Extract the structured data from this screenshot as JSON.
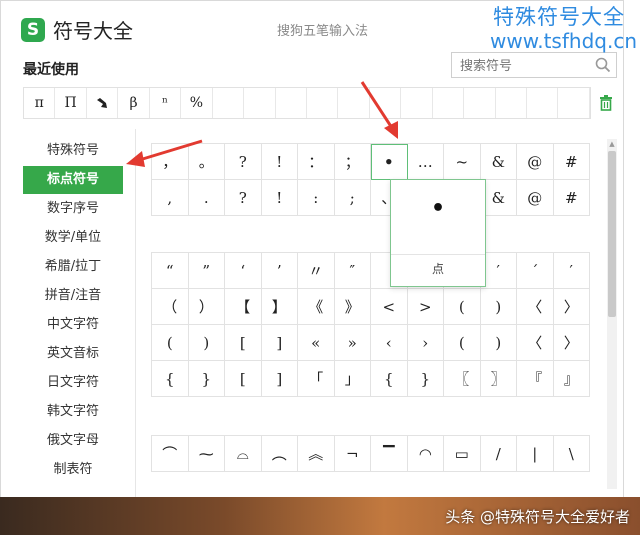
{
  "app": {
    "title": "符号大全",
    "logo_glyph": "S",
    "ime_hint": "搜狗五笔输入法",
    "brand_line1": "特殊符号大全",
    "brand_line2": "www.tsfhdq.cn"
  },
  "recent": {
    "label": "最近使用",
    "items": [
      "π",
      "Π",
      "",
      "β",
      "ⁿ",
      "%",
      "",
      "",
      "",
      "",
      "",
      "",
      "",
      "",
      "",
      "",
      "",
      ""
    ]
  },
  "search": {
    "placeholder": "搜索符号"
  },
  "sidebar": {
    "active_index": 1,
    "items": [
      "特殊符号",
      "标点符号",
      "数字序号",
      "数学/单位",
      "希腊/拉丁",
      "拼音/注音",
      "中文字符",
      "英文音标",
      "日文字符",
      "韩文字符",
      "俄文字母",
      "制表符"
    ]
  },
  "grid": {
    "block1": [
      [
        "，",
        "。",
        "?",
        "!",
        "：",
        "；",
        "•",
        "…",
        "~",
        "&",
        "@",
        "#"
      ],
      [
        ",",
        ".",
        "?",
        "!",
        ":",
        ";",
        "、",
        "",
        "",
        "&",
        "@",
        "#"
      ]
    ],
    "block2": [
      [
        "“",
        "”",
        "‘",
        "’",
        "〃",
        "″",
        "",
        "",
        "",
        "′",
        "´",
        "′"
      ],
      [
        "（",
        "）",
        "【",
        "】",
        "《",
        "》",
        "<",
        ">",
        "(",
        ")",
        "〈",
        "〉"
      ],
      [
        "(",
        ")",
        "[",
        "]",
        "«",
        "»",
        "‹",
        "›",
        "(",
        ")",
        "〈",
        "〉"
      ],
      [
        "{",
        "}",
        "[",
        "]",
        "「",
        "」",
        "{",
        "}",
        "〖",
        "〗",
        "『",
        "』"
      ]
    ],
    "block3": [
      [
        "⌒",
        "⁓",
        "⌓",
        "︵",
        "︽",
        "¬",
        "▔",
        "◠",
        "▭",
        "/",
        "|",
        "\\"
      ]
    ]
  },
  "popup": {
    "glyph": "•",
    "name": "点"
  },
  "watermark": "头条 @特殊符号大全爱好者",
  "colors": {
    "accent": "#36a84a",
    "brand": "#2f8be0",
    "arrow": "#e23a30"
  }
}
